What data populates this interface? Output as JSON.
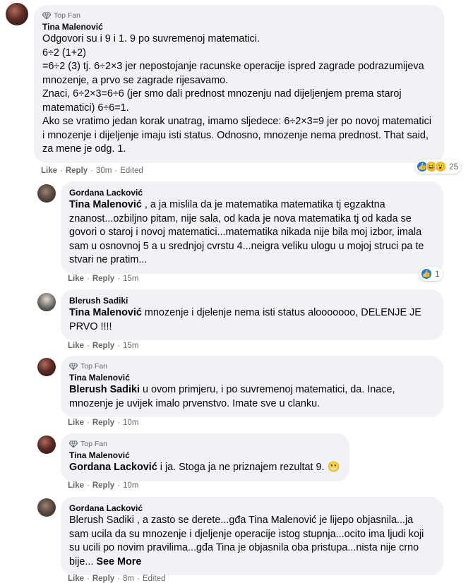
{
  "comments": [
    {
      "badge": "Top Fan",
      "author": "Tina Malenović",
      "text": "Odgovori su i 9 i 1. 9 po suvremenoj matematici.\n6÷2 (1+2)\n=6÷2 (3) tj. 6÷2×3 jer nepostojanje racunske operacije ispred zagrade podrazumijeva mnozenje, a prvo se zagrade rijesavamo.\nZnaci, 6÷2×3=6÷6 (jer smo dali prednost mnozenju nad dijeljenjem prema staroj matematici) 6÷6=1.\nAko se vratimo jedan korak unatrag, imamo sljedece: 6÷2×3=9 jer po novoj matematici i mnozenje i dijeljenje imaju isti status. Odnosno, mnozenje nema prednost. That said, za mene je odg. 1.",
      "like": "Like",
      "reply": "Reply",
      "time": "30m",
      "edited": "Edited",
      "reaction_count": "25"
    },
    {
      "author": "Gordana Lacković",
      "mention": "Tina Malenović",
      "text": " , a ja mislila da je matematika matematika tj egzaktna znanost...ozbiljno pitam, nije sala, od kada je nova matematika tj od kada se govori o staroj i novoj matematici...matematika nikada nije bila moj izbor, imala sam u osnovnoj 5 a u srednjoj cvrstu 4...neigra veliku ulogu u mojoj struci pa te stvari ne pratim...",
      "like": "Like",
      "reply": "Reply",
      "time": "15m",
      "reaction_count": "1"
    },
    {
      "author": "Blerush Sadiki",
      "mention": "Tina Malenović",
      "text": " mnozenje i djelenje nema isti status alooooooo, DELENJE JE PRVO !!!!",
      "like": "Like",
      "reply": "Reply",
      "time": "15m"
    },
    {
      "badge": "Top Fan",
      "author": "Tina Malenović",
      "mention": "Blerush Sadiki",
      "text": " u ovom primjeru, i po suvremenoj matematici, da. Inace, mnozenje je uvijek imalo prvenstvo. Imate sve u clanku.",
      "like": "Like",
      "reply": "Reply",
      "time": "10m"
    },
    {
      "badge": "Top Fan",
      "author": "Tina Malenović",
      "mention": "Gordana Lacković",
      "text": " i ja. Stoga ja ne priznajem rezultat 9. ",
      "emoji": "😬",
      "like": "Like",
      "reply": "Reply",
      "time": "10m"
    },
    {
      "author": "Gordana Lacković",
      "text": "Blerush Sadiki , a zasto se derete...gđa Tina Malenović je lijepo objasnila...ja sam ucila da su mnozenje i djeljenje operacije istog stupnja...ocito ima ljudi koji su ucili po novim pravilima...gđa Tina je objasnila oba pristupa...nista nije crno bije... ",
      "see_more": "See More",
      "like": "Like",
      "reply": "Reply",
      "time": "8m",
      "edited": "Edited"
    }
  ]
}
